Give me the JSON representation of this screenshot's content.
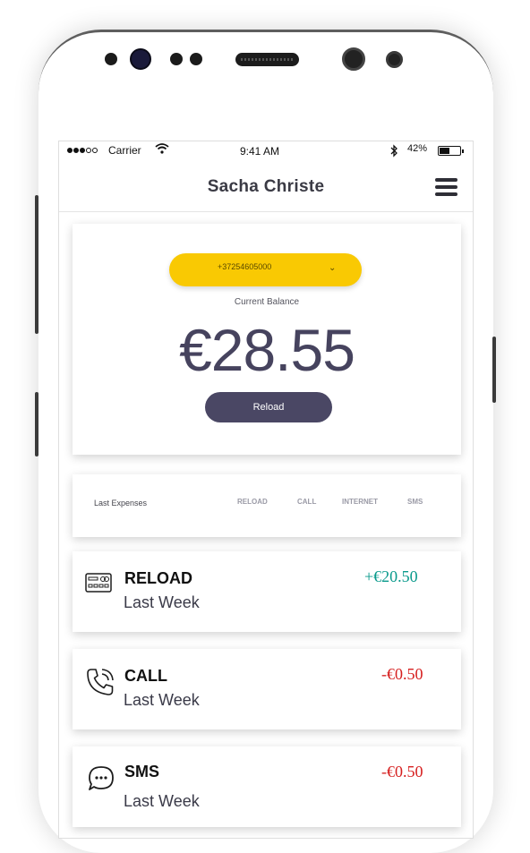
{
  "status_bar": {
    "carrier": "Carrier",
    "time": "9:41 AM",
    "battery": "42%"
  },
  "header": {
    "title": "Sacha Christe",
    "menu_icon": "hamburger-menu-icon"
  },
  "balance": {
    "phone_number": "+37254605000",
    "label": "Current Balance",
    "amount": "€28.55",
    "reload_label": "Reload"
  },
  "filter": {
    "label": "Last Expenses",
    "tabs": [
      "RELOAD",
      "CALL",
      "INTERNET",
      "SMS"
    ]
  },
  "transactions": [
    {
      "icon": "credit-card-icon",
      "title": "RELOAD",
      "period": "Last Week",
      "amount": "+€20.50",
      "color": "#0a9a8c"
    },
    {
      "icon": "phone-call-icon",
      "title": "CALL",
      "period": "Last Week",
      "amount": "-€0.50",
      "color": "#d62020"
    },
    {
      "icon": "chat-bubble-icon",
      "title": "SMS",
      "period": "Last Week",
      "amount": "-€0.50",
      "color": "#d62020"
    }
  ],
  "colors": {
    "accent_yellow": "#f9c903",
    "primary_dark": "#4a4764",
    "balance_text": "#46435e"
  }
}
